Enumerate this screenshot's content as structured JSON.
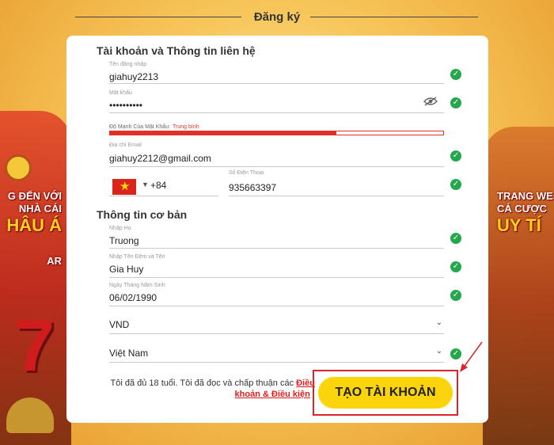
{
  "header": {
    "title": "Đăng ký"
  },
  "side_left": {
    "line1": "G ĐẾN VỚI",
    "line2": "NHÀ CÁI",
    "line3": "HÂU Á",
    "line4": "AR"
  },
  "side_right": {
    "line1": "TRANG WE",
    "line2": "CÁ CƯỢC",
    "line3": "UY TÍ"
  },
  "account_section": {
    "title": "Tài khoản và Thông tin liên hệ",
    "username": {
      "label": "Tên đăng nhập",
      "value": "giahuy2213"
    },
    "password": {
      "label": "Mật khẩu",
      "value": "••••••••••"
    },
    "strength": {
      "label": "Độ Mạnh Của Mật Khẩu:",
      "level": "Trung bình",
      "fill_percent": 68
    },
    "email": {
      "label": "Địa chỉ Email",
      "value": "giahuy2212@gmail.com"
    },
    "phone": {
      "country_code": "+84",
      "label": "Số Điện Thoại",
      "value": "935663397"
    }
  },
  "basic_section": {
    "title": "Thông tin cơ bản",
    "last_name": {
      "label": "Nhập Họ",
      "value": "Truong"
    },
    "first_name": {
      "label": "Nhập Tên Đệm và Tên",
      "value": "Gia Huy"
    },
    "birthdate": {
      "label": "Ngày Tháng Năm Sinh",
      "value": "06/02/1990"
    },
    "currency": {
      "value": "VND"
    },
    "country": {
      "value": "Việt Nam"
    }
  },
  "terms": {
    "text": "Tôi đã đủ 18 tuổi. Tôi đã đọc và chấp thuận các",
    "link": "Điều khoản & Điều kiện",
    "suffix": "."
  },
  "cta": {
    "label": "TẠO TÀI KHOẢN"
  },
  "colors": {
    "accent": "#fcd40b",
    "success": "#25a84b",
    "danger": "#e0302a"
  }
}
